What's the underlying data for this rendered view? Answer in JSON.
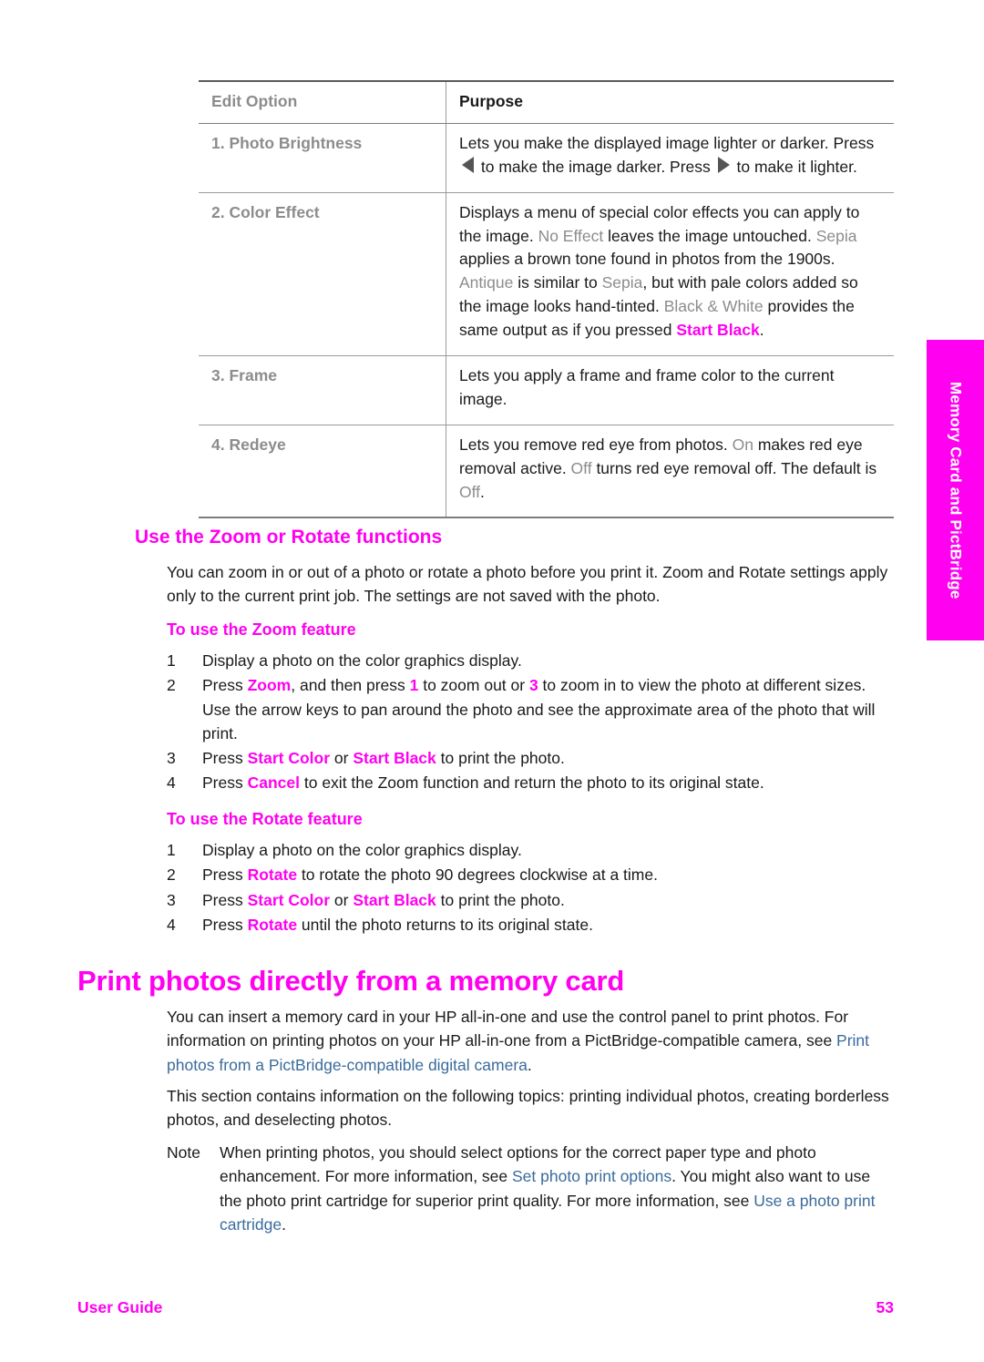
{
  "side_tab": {
    "label": "Memory Card and PictBridge"
  },
  "table": {
    "headers": [
      "Edit Option",
      "Purpose"
    ],
    "rows": [
      {
        "option": "1. Photo Brightness",
        "purpose_parts": [
          {
            "t": "Lets you make the displayed image lighter or darker. Press ",
            "s": "plain"
          },
          {
            "t": "",
            "s": "tri-left"
          },
          {
            "t": " to make the image darker. Press ",
            "s": "plain"
          },
          {
            "t": "",
            "s": "tri-right"
          },
          {
            "t": " to make it lighter.",
            "s": "plain"
          }
        ]
      },
      {
        "option": "2. Color Effect",
        "purpose_parts": [
          {
            "t": "Displays a menu of special color effects you can apply to the image. ",
            "s": "plain"
          },
          {
            "t": "No Effect",
            "s": "gray-em"
          },
          {
            "t": " leaves the image untouched. ",
            "s": "plain"
          },
          {
            "t": "Sepia",
            "s": "gray-em"
          },
          {
            "t": " applies a brown tone found in photos from the 1900s. ",
            "s": "plain"
          },
          {
            "t": "Antique",
            "s": "gray-em"
          },
          {
            "t": " is similar to ",
            "s": "plain"
          },
          {
            "t": "Sepia",
            "s": "gray-em"
          },
          {
            "t": ", but with pale colors added so the image looks hand-tinted. ",
            "s": "plain"
          },
          {
            "t": "Black & White",
            "s": "gray-em"
          },
          {
            "t": " provides the same output as if you pressed ",
            "s": "plain"
          },
          {
            "t": "Start Black",
            "s": "magenta"
          },
          {
            "t": ".",
            "s": "plain"
          }
        ]
      },
      {
        "option": "3. Frame",
        "purpose_parts": [
          {
            "t": "Lets you apply a frame and frame color to the current image.",
            "s": "plain"
          }
        ]
      },
      {
        "option": "4. Redeye",
        "purpose_parts": [
          {
            "t": "Lets you remove red eye from photos. ",
            "s": "plain"
          },
          {
            "t": "On",
            "s": "gray-em"
          },
          {
            "t": " makes red eye removal active. ",
            "s": "plain"
          },
          {
            "t": "Off",
            "s": "gray-em"
          },
          {
            "t": " turns red eye removal off. The default is ",
            "s": "plain"
          },
          {
            "t": "Off",
            "s": "gray-em"
          },
          {
            "t": ".",
            "s": "plain"
          }
        ]
      }
    ]
  },
  "zoom_rotate_section": {
    "heading": "Use the Zoom or Rotate functions",
    "intro": "You can zoom in or out of a photo or rotate a photo before you print it. Zoom and Rotate settings apply only to the current print job. The settings are not saved with the photo.",
    "zoom_heading": "To use the Zoom feature",
    "zoom_steps": [
      {
        "num": "1",
        "parts": [
          {
            "t": "Display a photo on the color graphics display.",
            "s": "plain"
          }
        ]
      },
      {
        "num": "2",
        "parts": [
          {
            "t": "Press ",
            "s": "plain"
          },
          {
            "t": "Zoom",
            "s": "magenta"
          },
          {
            "t": ", and then press ",
            "s": "plain"
          },
          {
            "t": "1",
            "s": "magenta"
          },
          {
            "t": " to zoom out or ",
            "s": "plain"
          },
          {
            "t": "3",
            "s": "magenta"
          },
          {
            "t": " to zoom in to view the photo at different sizes. Use the arrow keys to pan around the photo and see the approximate area of the photo that will print.",
            "s": "plain"
          }
        ]
      },
      {
        "num": "3",
        "parts": [
          {
            "t": "Press ",
            "s": "plain"
          },
          {
            "t": "Start Color",
            "s": "magenta"
          },
          {
            "t": " or ",
            "s": "plain"
          },
          {
            "t": "Start Black",
            "s": "magenta"
          },
          {
            "t": " to print the photo.",
            "s": "plain"
          }
        ]
      },
      {
        "num": "4",
        "parts": [
          {
            "t": "Press ",
            "s": "plain"
          },
          {
            "t": "Cancel",
            "s": "magenta"
          },
          {
            "t": " to exit the Zoom function and return the photo to its original state.",
            "s": "plain"
          }
        ]
      }
    ],
    "rotate_heading": "To use the Rotate feature",
    "rotate_steps": [
      {
        "num": "1",
        "parts": [
          {
            "t": "Display a photo on the color graphics display.",
            "s": "plain"
          }
        ]
      },
      {
        "num": "2",
        "parts": [
          {
            "t": "Press ",
            "s": "plain"
          },
          {
            "t": "Rotate",
            "s": "magenta"
          },
          {
            "t": " to rotate the photo 90 degrees clockwise at a time.",
            "s": "plain"
          }
        ]
      },
      {
        "num": "3",
        "parts": [
          {
            "t": "Press ",
            "s": "plain"
          },
          {
            "t": "Start Color",
            "s": "magenta"
          },
          {
            "t": " or ",
            "s": "plain"
          },
          {
            "t": "Start Black",
            "s": "magenta"
          },
          {
            "t": " to print the photo.",
            "s": "plain"
          }
        ]
      },
      {
        "num": "4",
        "parts": [
          {
            "t": "Press ",
            "s": "plain"
          },
          {
            "t": "Rotate",
            "s": "magenta"
          },
          {
            "t": " until the photo returns to its original state.",
            "s": "plain"
          }
        ]
      }
    ]
  },
  "memory_card_section": {
    "heading": "Print photos directly from a memory card",
    "par1_parts": [
      {
        "t": "You can insert a memory card in your HP all-in-one and use the control panel to print photos. For information on printing photos on your HP all-in-one from a PictBridge-compatible camera, see ",
        "s": "plain"
      },
      {
        "t": "Print photos from a PictBridge-compatible digital camera",
        "s": "xref"
      },
      {
        "t": ".",
        "s": "plain"
      }
    ],
    "par2": "This section contains information on the following topics: printing individual photos, creating borderless photos, and deselecting photos.",
    "note_label": "Note",
    "note_parts": [
      {
        "t": "When printing photos, you should select options for the correct paper type and photo enhancement. For more information, see ",
        "s": "plain"
      },
      {
        "t": "Set photo print options",
        "s": "xref"
      },
      {
        "t": ". You might also want to use the photo print cartridge for superior print quality. For more information, see ",
        "s": "plain"
      },
      {
        "t": "Use a photo print cartridge",
        "s": "xref"
      },
      {
        "t": ".",
        "s": "plain"
      }
    ]
  },
  "footer": {
    "left": "User Guide",
    "right": "53"
  },
  "colors": {
    "accent_magenta": "#ff00f0",
    "gray_emphasis": "#8c8c8c",
    "xref_blue": "#3a6b9c",
    "body_text": "#1a1a1a",
    "rule_gray": "#9a9a9a"
  }
}
